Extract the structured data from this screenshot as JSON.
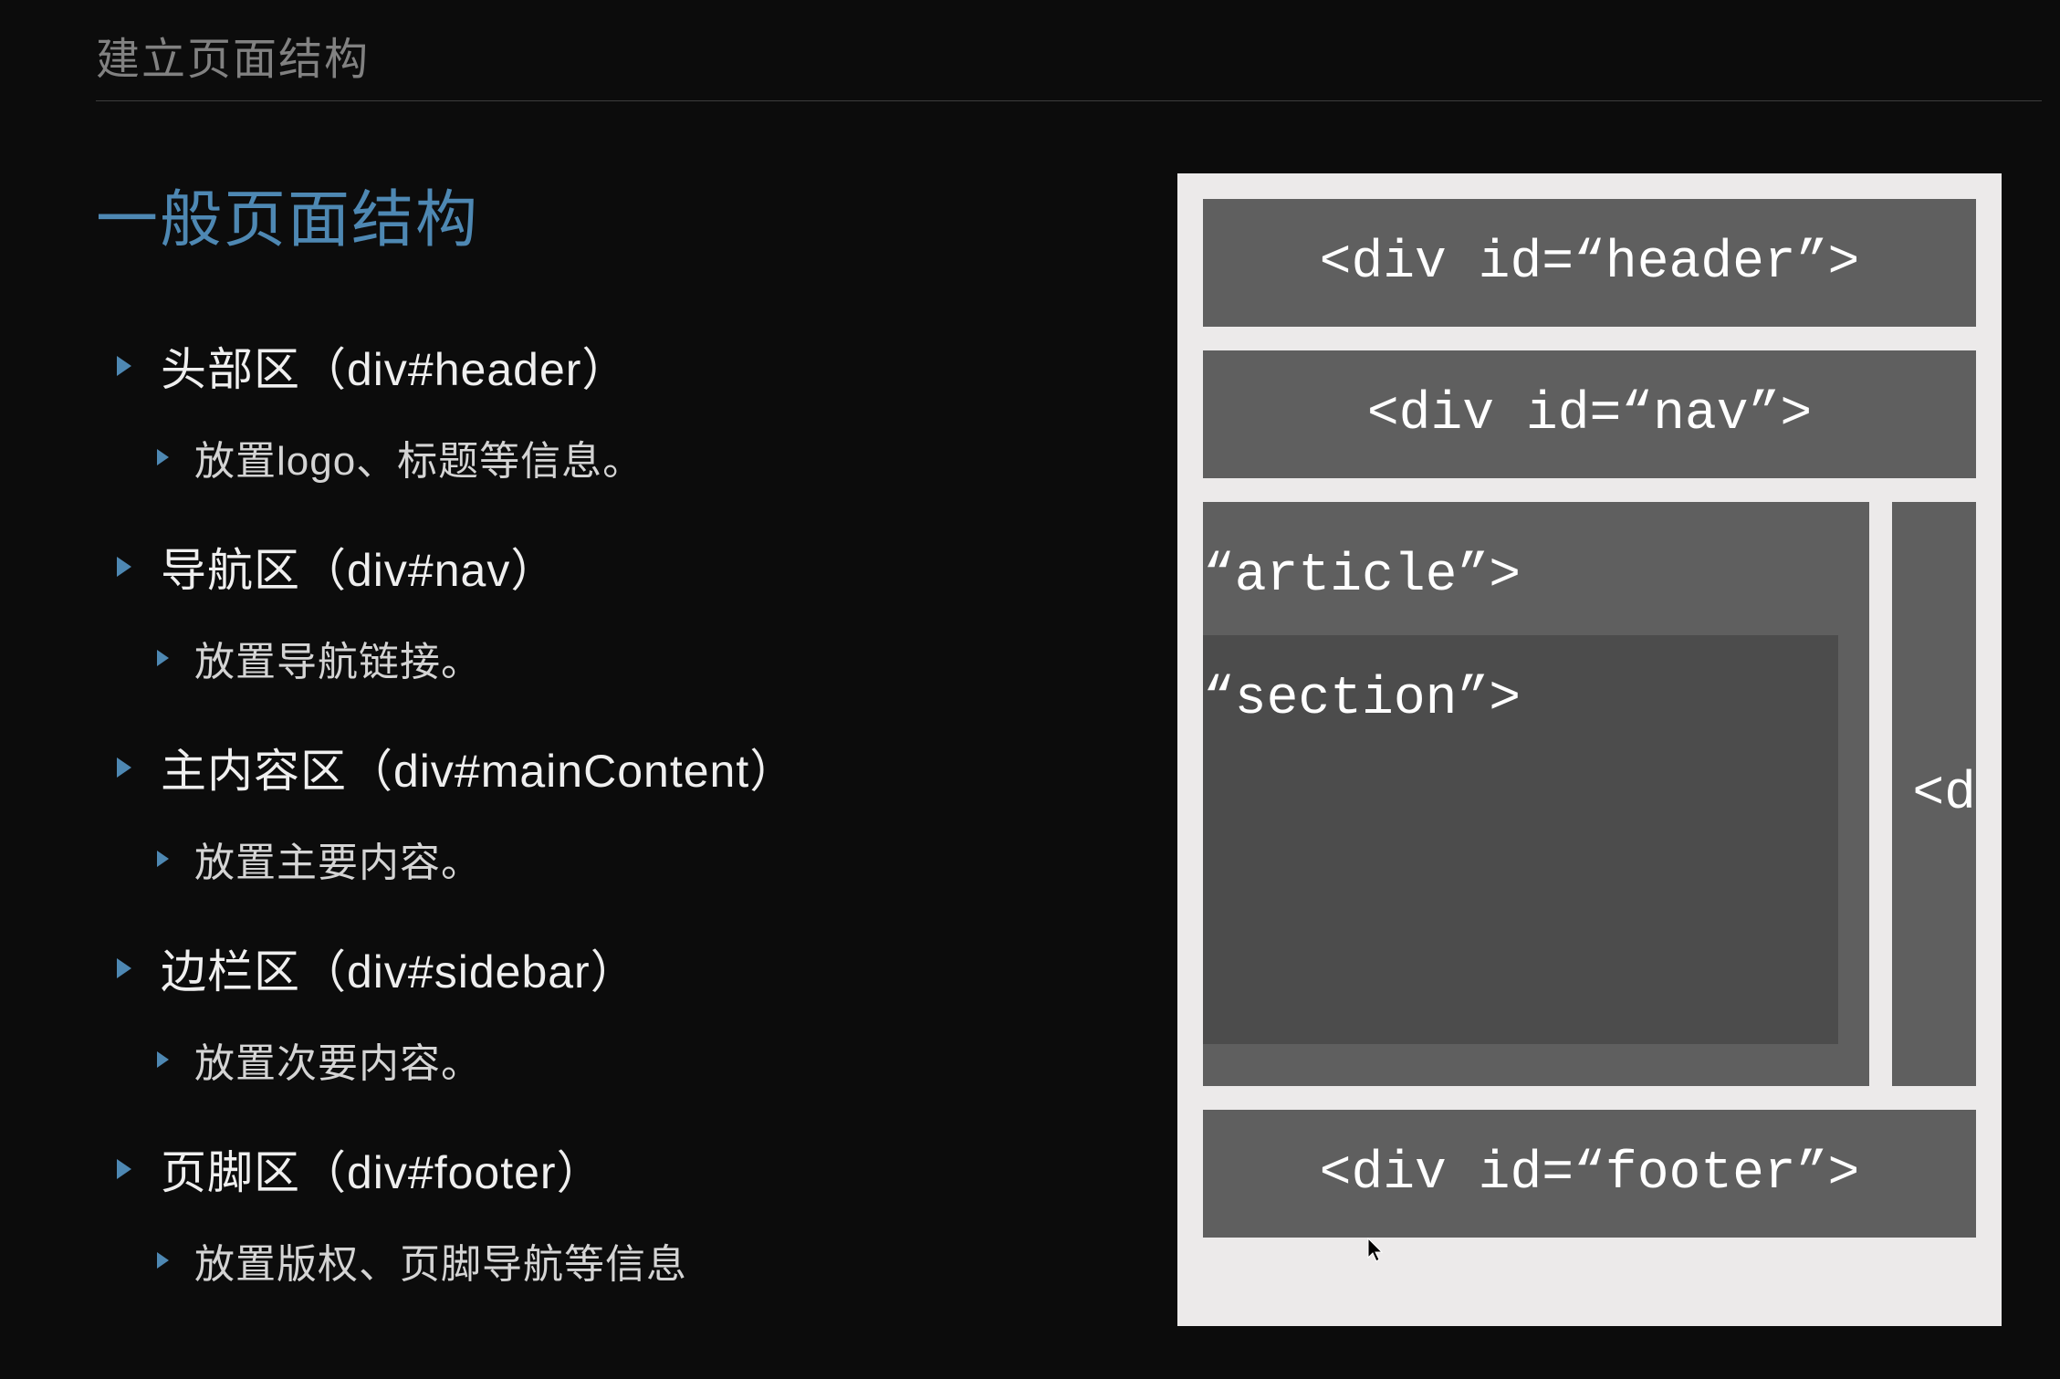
{
  "slide": {
    "title": "建立页面结构",
    "heading": "一般页面结构",
    "items": [
      {
        "label": "头部区（div#header）",
        "sub": "放置logo、标题等信息。"
      },
      {
        "label": "导航区（div#nav）",
        "sub": "放置导航链接。"
      },
      {
        "label": "主内容区（div#mainContent）",
        "sub": "放置主要内容。"
      },
      {
        "label": "边栏区（div#sidebar）",
        "sub": "放置次要内容。"
      },
      {
        "label": "页脚区（div#footer）",
        "sub": "放置版权、页脚导航等信息"
      }
    ]
  },
  "diagram": {
    "header": "<div id=“header”>",
    "nav": "<div id=“nav”>",
    "article": "“article”>",
    "section": "“section”>",
    "sidebar": "<d",
    "footer": "<div id=“footer”>"
  }
}
